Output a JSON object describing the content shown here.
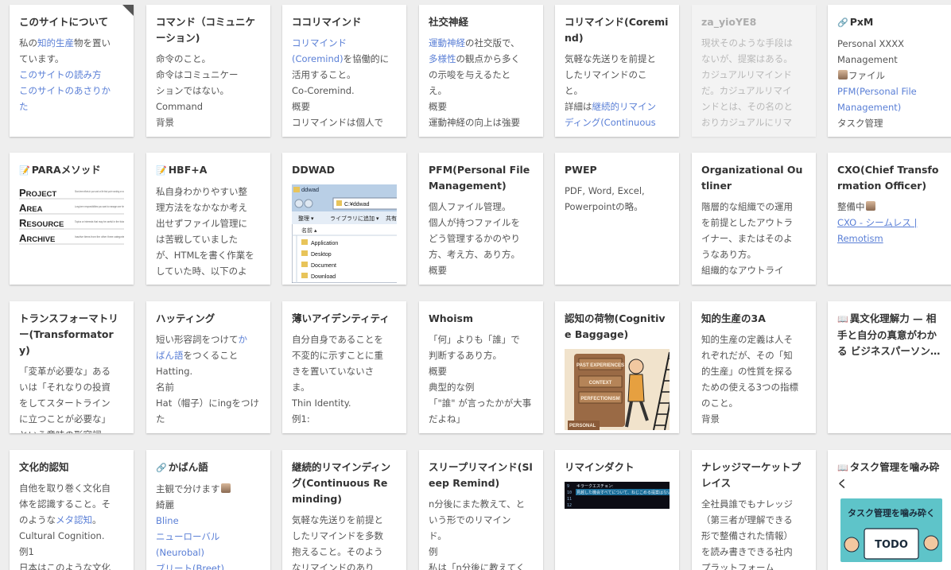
{
  "colors": {
    "page_bg": "#eeeeee",
    "card_bg": "#ffffff",
    "title": "#333333",
    "text": "#555555",
    "link": "#5a7fd6"
  },
  "cards": [
    {
      "title": "このサイトについて",
      "lines": [
        [
          {
            "t": "私の"
          },
          {
            "t": "知的生産",
            "link": true
          },
          {
            "t": "物を置い"
          }
        ],
        [
          {
            "t": "ています。"
          }
        ],
        [
          {
            "t": "このサイトの読み方",
            "link": true
          }
        ],
        [
          {
            "t": "このサイトのあさりか",
            "link": true
          }
        ],
        [
          {
            "t": "た",
            "link": true
          }
        ]
      ]
    },
    {
      "title": "コマンド（コミュニケーション)",
      "lines": [
        [
          {
            "t": "命令のこと。"
          }
        ],
        [
          {
            "t": "命令はコミュニケー"
          }
        ],
        [
          {
            "t": "ションではない。"
          }
        ],
        [
          {
            "t": "Command"
          }
        ],
        [
          {
            "t": "背景"
          }
        ]
      ]
    },
    {
      "title": "ココリマインド",
      "lines": [
        [
          {
            "t": "コリマインド",
            "link": true
          }
        ],
        [
          {
            "t": "(Coremind)",
            "link": true
          },
          {
            "t": "を協働的に"
          }
        ],
        [
          {
            "t": "活用すること。"
          }
        ],
        [
          {
            "t": "Co-Coremind."
          }
        ],
        [
          {
            "t": "概要"
          }
        ],
        [
          {
            "t": "コリマインドは個人で"
          }
        ]
      ]
    },
    {
      "title": "社交神経",
      "lines": [
        [
          {
            "t": "運動神経",
            "link": true
          },
          {
            "t": "の社交版で、"
          }
        ],
        [
          {
            "t": "多様性",
            "link": true
          },
          {
            "t": "の観点から多く"
          }
        ],
        [
          {
            "t": "の示唆を与えるたと"
          }
        ],
        [
          {
            "t": "え。"
          }
        ],
        [
          {
            "t": "概要"
          }
        ],
        [
          {
            "t": "運動神経の向上は強要"
          }
        ]
      ]
    },
    {
      "title": "コリマインド(Coremind)",
      "lines": [
        [
          {
            "t": "気軽な先送りを前提と"
          }
        ],
        [
          {
            "t": "したリマインドのこ"
          }
        ],
        [
          {
            "t": "と。"
          }
        ],
        [
          {
            "t": "詳細は"
          },
          {
            "t": "継続的リマイン",
            "link": true
          }
        ],
        [
          {
            "t": "ディング(Continuous",
            "link": true
          }
        ]
      ]
    },
    {
      "title": "za_yioYE8",
      "lines": [
        [
          {
            "t": "現状そのような手段は"
          }
        ],
        [
          {
            "t": "ないが、提案はある。"
          }
        ],
        [
          {
            "t": "カジュアルリマインド"
          }
        ],
        [
          {
            "t": "だ。カジュアルリマイ"
          }
        ],
        [
          {
            "t": "ンドとは、その名のと"
          }
        ],
        [
          {
            "t": "おりカジュアルにリマ"
          }
        ]
      ]
    },
    {
      "title": "PxM",
      "lines": [
        [
          {
            "t": "Personal XXXX"
          }
        ],
        [
          {
            "t": "Management"
          }
        ],
        [
          {
            "t": "ファイル"
          }
        ],
        [
          {
            "t": "PFM(Personal File",
            "link": true
          }
        ],
        [
          {
            "t": "Management)",
            "link": true
          }
        ],
        [
          {
            "t": "タスク管理"
          }
        ]
      ]
    },
    {
      "title": "PARAメソッド",
      "lines": [],
      "para": [
        {
          "big": "P",
          "rest": "ROJECT",
          "desc": "Short-term efforts in your work or life that you're working on now"
        },
        {
          "big": "A",
          "rest": "REA",
          "desc": "Long-term responsibilities you want to manage over time"
        },
        {
          "big": "R",
          "rest": "ESOURCE",
          "desc": "Topics or interests that may be useful in the future"
        },
        {
          "big": "A",
          "rest": "RCHIVE",
          "desc": "Inactive items from the other three categories"
        }
      ]
    },
    {
      "title": "HBF+A",
      "lines": [
        [
          {
            "t": "私自身わかりやすい整"
          }
        ],
        [
          {
            "t": "理方法をなかなか考え"
          }
        ],
        [
          {
            "t": "出せずファイル管理に"
          }
        ],
        [
          {
            "t": "は苦戦していました"
          }
        ],
        [
          {
            "t": "が、HTMLを書く作業を"
          }
        ],
        [
          {
            "t": "していた時、以下のよ"
          }
        ]
      ]
    },
    {
      "title": "DDWAD",
      "lines": [],
      "explorer": {
        "window_title": "ddwad",
        "path": "C:¥ddwad",
        "toolbar": [
          "整理 ▾",
          "ライブラリに追加 ▾",
          "共有 ▾"
        ],
        "column": "名前 ▴",
        "folders": [
          "Application",
          "Desktop",
          "Document",
          "Download"
        ]
      }
    },
    {
      "title": "PFM(Personal File Management)",
      "lines": [
        [
          {
            "t": "個人ファイル管理。"
          }
        ],
        [
          {
            "t": "個人が持つファイルを"
          }
        ],
        [
          {
            "t": "どう管理するかのやり"
          }
        ],
        [
          {
            "t": "方、考え方、あり方。"
          }
        ],
        [
          {
            "t": "概要"
          }
        ]
      ]
    },
    {
      "title": "PWEP",
      "lines": [
        [
          {
            "t": "PDF, Word, Excel,"
          }
        ],
        [
          {
            "t": "Powerpointの略。"
          }
        ]
      ]
    },
    {
      "title": "Organizational Outliner",
      "lines": [
        [
          {
            "t": "階層的な組織での運用"
          }
        ],
        [
          {
            "t": "を前提としたアウトラ"
          }
        ],
        [
          {
            "t": "イナー、またはそのよ"
          }
        ],
        [
          {
            "t": "うなあり方。"
          }
        ],
        [
          {
            "t": "組織的なアウトライ"
          }
        ]
      ]
    },
    {
      "title": "CXO(Chief Transformation Officer)",
      "lines": [
        [
          {
            "t": "整備中"
          }
        ],
        [
          {
            "t": "CXO - シームレス |",
            "link": true
          }
        ],
        [
          {
            "t": "Remotism",
            "link": true
          }
        ]
      ]
    },
    {
      "title": "トランスフォーマトリー(Transformatory)",
      "lines": [
        [
          {
            "t": "「変革が必要な」ある"
          }
        ],
        [
          {
            "t": "いは「それなりの投資"
          }
        ],
        [
          {
            "t": "をしてスタートライン"
          }
        ],
        [
          {
            "t": "に立つことが必要な」"
          }
        ],
        [
          {
            "t": "という意味の形容詞。"
          }
        ]
      ]
    },
    {
      "title": "ハッティング",
      "lines": [
        [
          {
            "t": "短い形容詞をつけて"
          },
          {
            "t": "か",
            "link": true
          }
        ],
        [
          {
            "t": "ばん語",
            "link": true
          },
          {
            "t": "をつくること"
          }
        ],
        [
          {
            "t": "Hatting."
          }
        ],
        [
          {
            "t": "名前"
          }
        ],
        [
          {
            "t": "Hat（帽子）にingをつけ"
          }
        ],
        [
          {
            "t": "た"
          }
        ]
      ]
    },
    {
      "title": "薄いアイデンティティ",
      "lines": [
        [
          {
            "t": "自分自身であることを"
          }
        ],
        [
          {
            "t": "不変的に示すことに重"
          }
        ],
        [
          {
            "t": "きを置いていないさ"
          }
        ],
        [
          {
            "t": "ま。"
          }
        ],
        [
          {
            "t": "Thin Identity."
          }
        ],
        [
          {
            "t": "例1:"
          }
        ]
      ]
    },
    {
      "title": "Whoism",
      "lines": [
        [
          {
            "t": "「何」よりも「誰」で"
          }
        ],
        [
          {
            "t": "判断するあり方。"
          }
        ],
        [
          {
            "t": "概要"
          }
        ],
        [
          {
            "t": "典型的な例"
          }
        ],
        [
          {
            "t": "「\"誰\" が言ったかが大事"
          }
        ],
        [
          {
            "t": "だよね」"
          }
        ]
      ]
    },
    {
      "title": "認知の荷物(Cognitive Baggage)",
      "lines": [],
      "baggage": [
        "PAST EXPERIENCES",
        "CONTEXT",
        "PERFECTIONISM",
        "PERSONAL"
      ]
    },
    {
      "title": "知的生産の3A",
      "lines": [
        [
          {
            "t": "知的生産の定義は人そ"
          }
        ],
        [
          {
            "t": "れぞれだが、その「知"
          }
        ],
        [
          {
            "t": "的生産」の性質を探る"
          }
        ],
        [
          {
            "t": "ための使える3つの指標"
          }
        ],
        [
          {
            "t": "のこと。"
          }
        ],
        [
          {
            "t": "背景"
          }
        ]
      ]
    },
    {
      "title": "異文化理解力 — 相手と自分の真意がわかる ビジネスパーソン…",
      "lines": []
    },
    {
      "title": "文化的認知",
      "lines": [
        [
          {
            "t": "自他を取り巻く文化自"
          }
        ],
        [
          {
            "t": "体を認識すること。そ"
          }
        ],
        [
          {
            "t": "のような"
          },
          {
            "t": "メタ認知",
            "link": true
          },
          {
            "t": "。"
          }
        ],
        [
          {
            "t": "Cultural Cognition."
          }
        ],
        [
          {
            "t": "例1"
          }
        ],
        [
          {
            "t": "日本はこのような文化"
          }
        ]
      ]
    },
    {
      "title": "かばん語",
      "lines": [
        [
          {
            "t": "主観で分けます"
          }
        ],
        [
          {
            "t": "綺麗"
          }
        ],
        [
          {
            "t": "Bline",
            "link": true
          }
        ],
        [
          {
            "t": "ニューローバル",
            "link": true
          }
        ],
        [
          {
            "t": "(Neurobal)",
            "link": true
          }
        ],
        [
          {
            "t": "ブリート(Breet)",
            "link": true
          }
        ]
      ]
    },
    {
      "title": "継続的リマインディング(Continuous Reminding)",
      "lines": [
        [
          {
            "t": "気軽な先送りを前提と"
          }
        ],
        [
          {
            "t": "したリマインドを多数"
          }
        ],
        [
          {
            "t": "抱えること。そのよう"
          }
        ],
        [
          {
            "t": "なリマインドのあり"
          }
        ]
      ]
    },
    {
      "title": "スリープリマインド(Sleep Remind)",
      "lines": [
        [
          {
            "t": "n分後にまた教えて、と"
          }
        ],
        [
          {
            "t": "いう形でのリマイン"
          }
        ],
        [
          {
            "t": "ド。"
          }
        ],
        [
          {
            "t": "例"
          }
        ],
        [
          {
            "t": "私は「n分後に教えてく"
          }
        ]
      ]
    },
    {
      "title": "リマインダクト",
      "lines": [],
      "terminal": [
        {
          "n": "9",
          "t": "キラークエスチョン:"
        },
        {
          "n": "10",
          "t": "見越した機会すべてについて、ねじこめる提案はないか?"
        },
        {
          "n": "11",
          "t": ""
        },
        {
          "n": "12",
          "t": ""
        }
      ]
    },
    {
      "title": "ナレッジマーケットプレイス",
      "lines": [
        [
          {
            "t": "全社員誰でもナレッジ"
          }
        ],
        [
          {
            "t": "（第三者が理解できる"
          }
        ],
        [
          {
            "t": "形で整備された情報）"
          }
        ],
        [
          {
            "t": "を読み書きできる社内"
          }
        ],
        [
          {
            "t": "プラットフォーム"
          }
        ]
      ]
    },
    {
      "title": "タスク管理を噛み砕く",
      "lines": [],
      "cover": {
        "title": "タスク管理を噛み砕く",
        "num": "TODO"
      }
    }
  ]
}
